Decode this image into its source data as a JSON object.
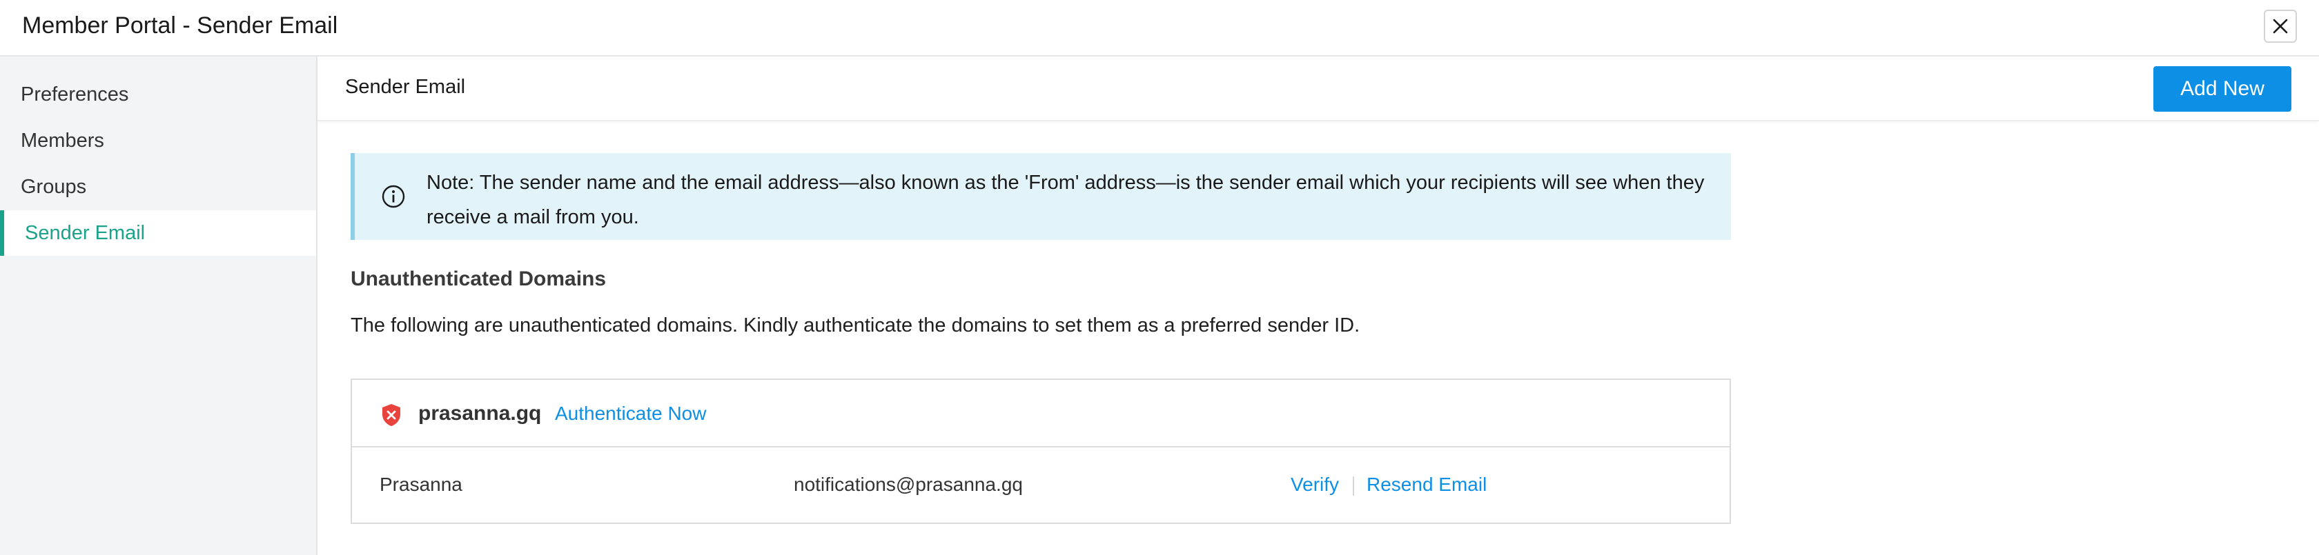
{
  "window": {
    "title": "Member Portal - Sender Email",
    "close_icon": "close-icon"
  },
  "sidebar": {
    "items": [
      {
        "label": "Preferences",
        "active": false
      },
      {
        "label": "Members",
        "active": false
      },
      {
        "label": "Groups",
        "active": false
      },
      {
        "label": "Sender Email",
        "active": true
      }
    ],
    "active_color": "#1aa38a"
  },
  "header": {
    "title": "Sender Email",
    "add_new_label": "Add New",
    "accent": "#0e8fe6"
  },
  "note": {
    "icon": "info-icon",
    "text": "Note: The sender name and the email address—also known as the 'From' address—is the sender email which your recipients will see when they receive a mail from you."
  },
  "unauthenticated": {
    "title": "Unauthenticated Domains",
    "description": "The following are unauthenticated domains. Kindly authenticate the domains to set them as a preferred sender ID.",
    "domains": [
      {
        "icon": "shield-warning-icon",
        "name": "prasanna.gq",
        "action_label": "Authenticate Now",
        "senders": [
          {
            "name": "Prasanna",
            "email": "notifications@prasanna.gq",
            "verify_label": "Verify",
            "resend_label": "Resend Email"
          }
        ]
      }
    ]
  }
}
